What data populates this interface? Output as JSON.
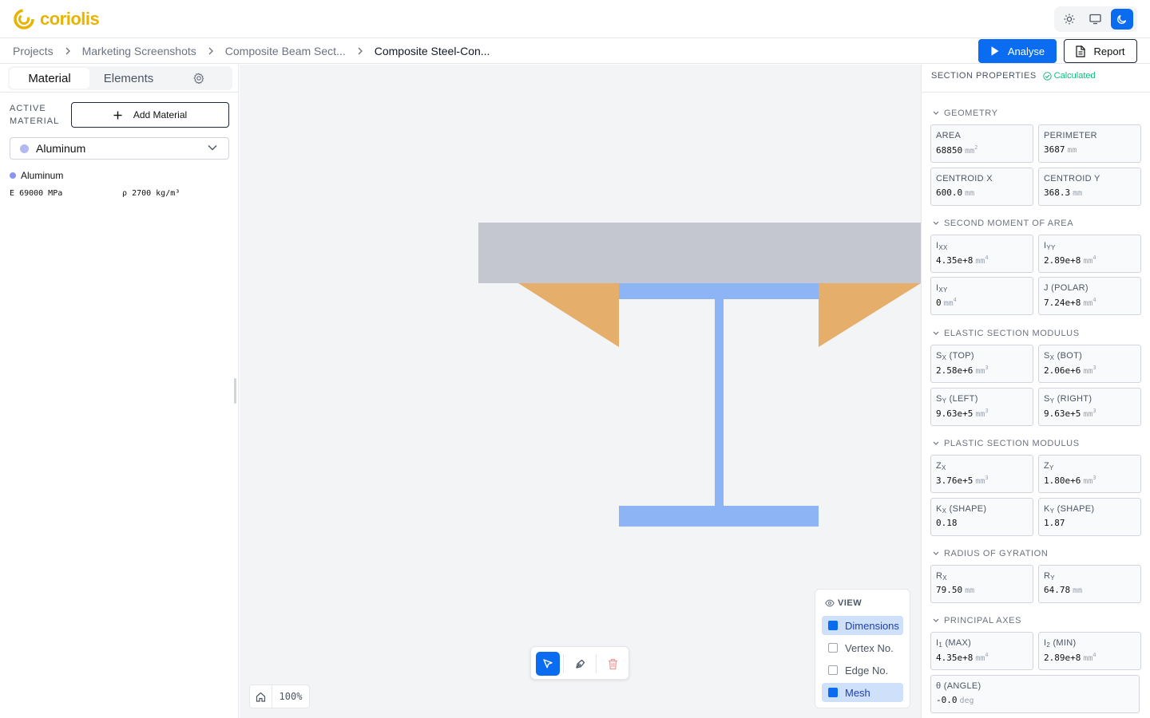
{
  "app": {
    "name": "coriolis"
  },
  "breadcrumbs": [
    "Projects",
    "Marketing Screenshots",
    "Composite Beam Sect...",
    "Composite Steel-Con..."
  ],
  "actions": {
    "analyse": "Analyse",
    "report": "Report"
  },
  "left_panel": {
    "tabs": {
      "material": "Material",
      "elements": "Elements"
    },
    "active_material_label": "ACTIVE MATERIAL",
    "add_material": "Add Material",
    "selected_material": "Aluminum",
    "material_name": "Aluminum",
    "e_label": "E",
    "e_value": "69000 MPa",
    "rho_label": "ρ",
    "rho_value": "2700 kg/m³"
  },
  "canvas": {
    "zoom": "100%"
  },
  "view": {
    "title": "VIEW",
    "options": [
      {
        "label": "Dimensions",
        "checked": true
      },
      {
        "label": "Vertex No.",
        "checked": false
      },
      {
        "label": "Edge No.",
        "checked": false
      },
      {
        "label": "Mesh",
        "checked": true
      }
    ]
  },
  "section_properties": {
    "title": "SECTION PROPERTIES",
    "status": "Calculated",
    "groups": {
      "geometry": "GEOMETRY",
      "second_moment": "SECOND MOMENT OF AREA",
      "elastic": "ELASTIC SECTION MODULUS",
      "plastic": "PLASTIC SECTION MODULUS",
      "gyration": "RADIUS OF GYRATION",
      "principal": "PRINCIPAL AXES"
    },
    "area": {
      "label": "AREA",
      "value": "68850",
      "unit": "mm"
    },
    "perimeter": {
      "label": "PERIMETER",
      "value": "3687",
      "unit": "mm"
    },
    "centroid_x": {
      "label": "CENTROID X",
      "value": "600.0",
      "unit": "mm"
    },
    "centroid_y": {
      "label": "CENTROID Y",
      "value": "368.3",
      "unit": "mm"
    },
    "ixx": {
      "label": "I",
      "sub": "XX",
      "value": "4.35e+8",
      "unit": "mm"
    },
    "iyy": {
      "label": "I",
      "sub": "YY",
      "value": "2.89e+8",
      "unit": "mm"
    },
    "ixy": {
      "label": "I",
      "sub": "XY",
      "value": "0",
      "unit": "mm"
    },
    "j": {
      "label": "J (POLAR)",
      "value": "7.24e+8",
      "unit": "mm"
    },
    "sx_top": {
      "label": "S",
      "sub": "X",
      "suffix": " (TOP)",
      "value": "2.58e+6",
      "unit": "mm"
    },
    "sx_bot": {
      "label": "S",
      "sub": "X",
      "suffix": " (BOT)",
      "value": "2.06e+6",
      "unit": "mm"
    },
    "sy_left": {
      "label": "S",
      "sub": "Y",
      "suffix": " (LEFT)",
      "value": "9.63e+5",
      "unit": "mm"
    },
    "sy_right": {
      "label": "S",
      "sub": "Y",
      "suffix": " (RIGHT)",
      "value": "9.63e+5",
      "unit": "mm"
    },
    "zx": {
      "label": "Z",
      "sub": "X",
      "value": "3.76e+5",
      "unit": "mm"
    },
    "zy": {
      "label": "Z",
      "sub": "Y",
      "value": "1.80e+6",
      "unit": "mm"
    },
    "kx": {
      "label": "K",
      "sub": "X",
      "suffix": " (SHAPE)",
      "value": "0.18"
    },
    "ky": {
      "label": "K",
      "sub": "Y",
      "suffix": " (SHAPE)",
      "value": "1.87"
    },
    "rx": {
      "label": "R",
      "sub": "X",
      "value": "79.50",
      "unit": "mm"
    },
    "ry": {
      "label": "R",
      "sub": "Y",
      "value": "64.78",
      "unit": "mm"
    },
    "i1": {
      "label": "I",
      "sub": "1",
      "suffix": " (MAX)",
      "value": "4.35e+8",
      "unit": "mm"
    },
    "i2": {
      "label": "I",
      "sub": "2",
      "suffix": " (MIN)",
      "value": "2.89e+8",
      "unit": "mm"
    },
    "theta": {
      "label": "θ (ANGLE)",
      "value": "-0.0",
      "unit": "deg"
    },
    "exponents": {
      "area": "2",
      "inertia": "4",
      "modulus": "3"
    }
  },
  "colors": {
    "accent": "#0a6cf0",
    "logo": "#e8b400",
    "concrete": "#c4c6d0",
    "steel": "#8db4f5",
    "haunch": "#e5ae6b",
    "status": "#10b981"
  }
}
